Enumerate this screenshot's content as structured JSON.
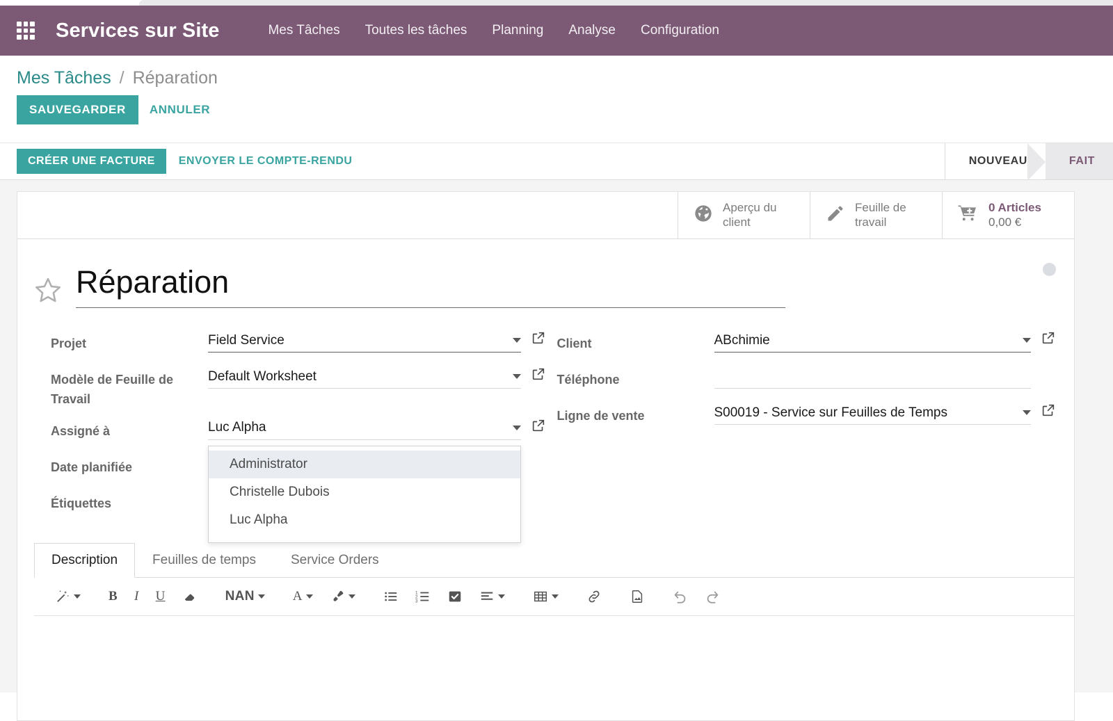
{
  "navbar": {
    "apps_icon": "apps-grid-icon",
    "brand": "Services sur Site",
    "menu": [
      {
        "label": "Mes Tâches"
      },
      {
        "label": "Toutes les tâches"
      },
      {
        "label": "Planning"
      },
      {
        "label": "Analyse"
      },
      {
        "label": "Configuration"
      }
    ]
  },
  "breadcrumb": {
    "parent": "Mes Tâches",
    "separator": "/",
    "current": "Réparation"
  },
  "control_panel": {
    "save_label": "SAUVEGARDER",
    "discard_label": "ANNULER"
  },
  "action_bar": {
    "create_invoice_label": "CRÉER UNE FACTURE",
    "send_report_label": "ENVOYER LE COMPTE-RENDU",
    "status_steps": [
      {
        "label": "NOUVEAU",
        "active": false
      },
      {
        "label": "FAIT",
        "active": true
      }
    ]
  },
  "stat_buttons": [
    {
      "icon": "globe-icon",
      "line1": "Aperçu du",
      "line2": "client"
    },
    {
      "icon": "pencil-icon",
      "line1": "Feuille de",
      "line2": "travail"
    },
    {
      "icon": "cart-plus-icon",
      "line1": "0 Articles",
      "line2": "0,00 €"
    }
  ],
  "record": {
    "star_icon": "star-outline-icon",
    "title": "Réparation",
    "kanban_state_dot": "kanban-state-grey-dot"
  },
  "fields": {
    "left": [
      {
        "label": "Projet",
        "value": "Field Service",
        "has_caret": true,
        "has_external": true,
        "focused": true
      },
      {
        "label": "Modèle de Feuille de Travail",
        "value": "Default Worksheet",
        "has_caret": true,
        "has_external": true,
        "focused": false
      },
      {
        "label": "Assigné à",
        "value": "Luc Alpha",
        "has_caret": true,
        "has_external": true,
        "focused": false
      },
      {
        "label": "Date planifiée",
        "value": "",
        "has_caret": false,
        "has_external": false,
        "focused": false
      },
      {
        "label": "Étiquettes",
        "value": "",
        "has_caret": false,
        "has_external": false,
        "focused": false
      }
    ],
    "right": [
      {
        "label": "Client",
        "value": "ABchimie",
        "has_caret": true,
        "has_external": true,
        "focused": true
      },
      {
        "label": "Téléphone",
        "value": "",
        "has_caret": false,
        "has_external": false,
        "focused": false
      },
      {
        "label": "Ligne de vente",
        "value": "S00019 - Service sur Feuilles de Temps",
        "has_caret": true,
        "has_external": true,
        "focused": false
      }
    ]
  },
  "assignee_dropdown": {
    "open": true,
    "options": [
      {
        "label": "Administrator",
        "highlighted": true
      },
      {
        "label": "Christelle Dubois",
        "highlighted": false
      },
      {
        "label": "Luc Alpha",
        "highlighted": false
      }
    ]
  },
  "notebook": {
    "tabs": [
      {
        "label": "Description",
        "active": true
      },
      {
        "label": "Feuilles de temps",
        "active": false
      },
      {
        "label": "Service Orders",
        "active": false
      }
    ],
    "toolbar": [
      {
        "icon": "magic-wand-icon",
        "label": "",
        "caret": true
      },
      {
        "icon": "bold-icon",
        "label": "B",
        "caret": false
      },
      {
        "icon": "italic-icon",
        "label": "I",
        "caret": false
      },
      {
        "icon": "underline-icon",
        "label": "U",
        "caret": false
      },
      {
        "icon": "eraser-icon",
        "label": "",
        "caret": false
      },
      {
        "icon": "font-size-icon",
        "label": "NAN",
        "caret": true
      },
      {
        "icon": "font-color-icon",
        "label": "A",
        "caret": true
      },
      {
        "icon": "background-color-icon",
        "label": "",
        "caret": true
      },
      {
        "icon": "unordered-list-icon",
        "label": "",
        "caret": false
      },
      {
        "icon": "ordered-list-icon",
        "label": "",
        "caret": false
      },
      {
        "icon": "checklist-icon",
        "label": "",
        "caret": false
      },
      {
        "icon": "align-left-icon",
        "label": "",
        "caret": true
      },
      {
        "icon": "table-icon",
        "label": "",
        "caret": true
      },
      {
        "icon": "link-icon",
        "label": "",
        "caret": false
      },
      {
        "icon": "image-icon",
        "label": "",
        "caret": false
      },
      {
        "icon": "undo-icon",
        "label": "",
        "caret": false
      },
      {
        "icon": "redo-icon",
        "label": "",
        "caret": false
      }
    ],
    "editor_content": ""
  },
  "colors": {
    "navbar": "#7c5a76",
    "accent_teal": "#39a4a0",
    "link_teal": "#2a8a88",
    "status_active": "#7c5a76",
    "stat_highlight": "#7c5a76"
  }
}
